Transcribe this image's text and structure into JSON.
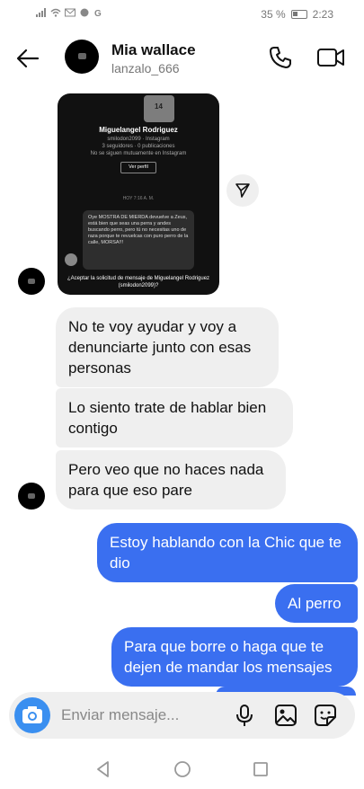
{
  "status_bar": {
    "battery": "35 %",
    "time": "2:23"
  },
  "header": {
    "name": "Mia wallace",
    "username": "lanzalo_666"
  },
  "shared_card": {
    "profile_name": "Miguelangel Rodriguez",
    "profile_handle": "smilodon2099 · Instagram",
    "profile_stats": "3 seguidores · 0 publicaciones",
    "profile_note": "No se siguen mutuamente en Instagram",
    "view_profile": "Ver perfil",
    "date": "HOY 7:16 A. M.",
    "message": "Oye MOSTRA DE MIERDA devuelve a Zeus, está bien que seas una perra y andes buscando perro, pero tú no necesitas uno de raza porque te revuelcas con puro perro de la calle, MORSA!!!",
    "request": "¿Aceptar la solicitud de mensaje de Miguelangel Rodriguez (smilodon2099)?"
  },
  "messages": [
    {
      "text": "No te voy ayudar y voy a denunciarte junto con esas personas",
      "side": "received"
    },
    {
      "text": "Lo siento trate de hablar bien contigo",
      "side": "received"
    },
    {
      "text": "Pero veo que no haces nada para que eso pare",
      "side": "received"
    },
    {
      "text": "Estoy hablando con la Chic que te dio",
      "side": "sent"
    },
    {
      "text": "Al perro",
      "side": "sent"
    },
    {
      "text": "Para que borre o haga que te dejen de mandar los mensajes",
      "side": "sent"
    }
  ],
  "composer": {
    "placeholder": "Enviar mensaje..."
  },
  "icons": {
    "back": "arrow-left-icon",
    "call": "phone-icon",
    "video": "video-camera-icon",
    "share": "send-icon",
    "camera": "camera-icon",
    "mic": "microphone-icon",
    "gallery": "image-icon",
    "sticker": "sticker-icon"
  },
  "colors": {
    "sent_bubble": "#3a6ff0",
    "received_bubble": "#efefef",
    "camera_button": "#3a8ff0"
  }
}
